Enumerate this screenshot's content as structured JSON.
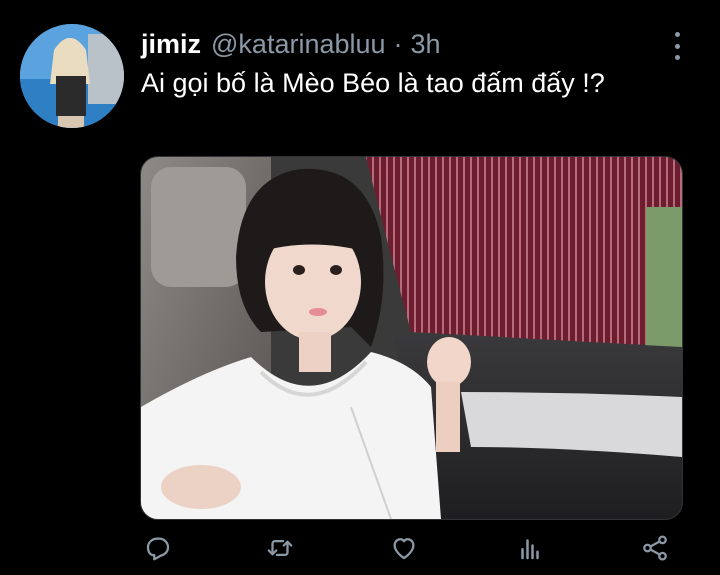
{
  "tweet": {
    "display_name": "jimiz",
    "handle": "@katarinabluu",
    "separator": "·",
    "time": "3h",
    "text": "Ai gọi bố là Mèo Béo là tao đấm đấy !?"
  },
  "actions": [
    {
      "icon": "reply-icon"
    },
    {
      "icon": "retweet-icon"
    },
    {
      "icon": "like-icon"
    },
    {
      "icon": "analytics-icon"
    },
    {
      "icon": "share-icon"
    }
  ],
  "colors": {
    "background": "#000000",
    "primary_text": "#ffffff",
    "secondary_text": "#8b98a5"
  }
}
